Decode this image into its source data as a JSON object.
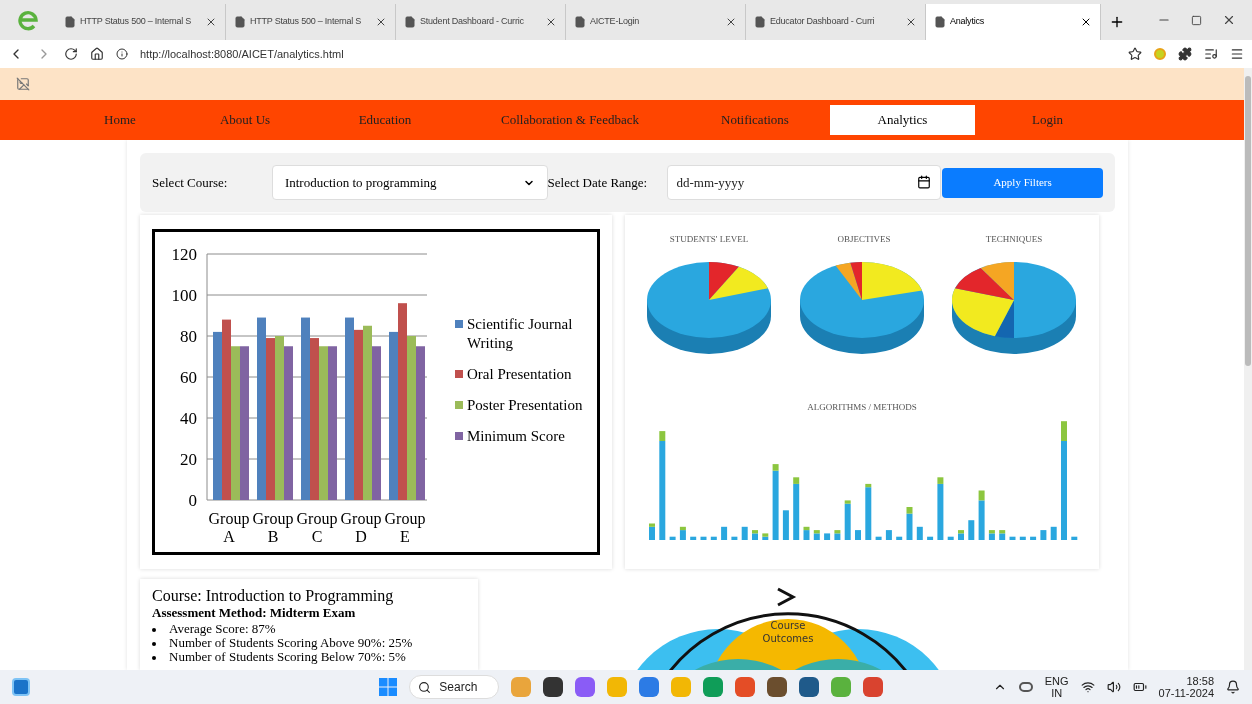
{
  "browser": {
    "tabs": [
      {
        "title": "HTTP Status 500 – Internal S",
        "selected": false
      },
      {
        "title": "HTTP Status 500 – Internal S",
        "selected": false
      },
      {
        "title": "Student Dashboard - Curric",
        "selected": false
      },
      {
        "title": "AICTE-Login",
        "selected": false
      },
      {
        "title": "Educator Dashboard - Curri",
        "selected": false
      },
      {
        "title": "Analytics",
        "selected": true
      }
    ],
    "url": "http://localhost:8080/AICET/analytics.html"
  },
  "nav": {
    "items": [
      {
        "label": "Home",
        "selected": false
      },
      {
        "label": "About Us",
        "selected": false
      },
      {
        "label": "Education",
        "selected": false
      },
      {
        "label": "Collaboration & Feedback",
        "selected": false
      },
      {
        "label": "Notifications",
        "selected": false
      },
      {
        "label": "Analytics",
        "selected": true
      },
      {
        "label": "Login",
        "selected": false
      }
    ]
  },
  "filters": {
    "course_label": "Select Course:",
    "course_value": "Introduction to programming",
    "date_label": "Select Date Range:",
    "date_placeholder": "dd-mm-yyyy",
    "apply_button": "Apply Filters"
  },
  "performance_chart": {
    "chart_data": {
      "type": "bar",
      "grid": true,
      "legend": true,
      "categories": [
        "Group A",
        "Group B",
        "Group C",
        "Group D",
        "Group E"
      ],
      "ylim": [
        0,
        120
      ],
      "yticks": [
        0,
        20,
        40,
        60,
        80,
        100,
        120
      ],
      "series": [
        {
          "name": "Scientific Journal Writing",
          "color": "#4f81bd",
          "values": [
            82,
            89,
            89,
            89,
            82
          ]
        },
        {
          "name": "Oral Presentation",
          "color": "#c0504d",
          "values": [
            88,
            79,
            79,
            83,
            96
          ]
        },
        {
          "name": "Poster Presentation",
          "color": "#9bbb59",
          "values": [
            75,
            80,
            75,
            85,
            80
          ]
        },
        {
          "name": "Minimum Score",
          "color": "#8064a2",
          "values": [
            75,
            75,
            75,
            75,
            75
          ]
        }
      ]
    }
  },
  "analytics_image": {
    "titles": [
      "STUDENTS' LEVEL",
      "OBJECTIVES",
      "TECHNIQUES",
      "ALGORITHMS / METHODS"
    ]
  },
  "assessment": {
    "title": "Course: Introduction to Programming",
    "method": "Assessment Method: Midterm Exam",
    "bullets": [
      "Average Score: 87%",
      "Number of Students Scoring Above 90%: 25%",
      "Number of Students Scoring Below 70%: 5%"
    ]
  },
  "outcomes_diagram": {
    "label": "Course Outcomes"
  },
  "taskbar": {
    "search": "Search",
    "language": "ENG",
    "region": "IN",
    "time": "18:58",
    "date": "07-11-2024"
  }
}
